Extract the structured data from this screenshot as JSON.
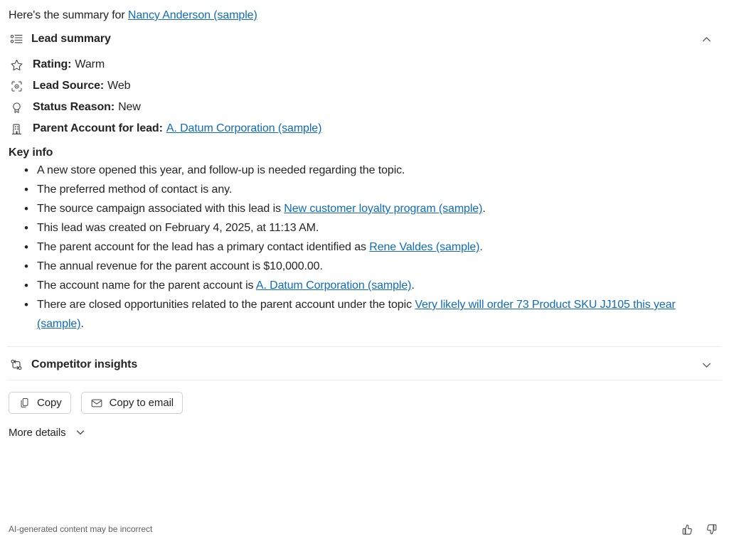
{
  "intro": {
    "prefix": "Here's the summary for ",
    "subject_link": "Nancy Anderson (sample)"
  },
  "lead_summary": {
    "icon": "bulleted-list-icon",
    "title": "Lead summary",
    "expanded": true,
    "chevron_icon": "chevron-up-icon",
    "fields": [
      {
        "icon": "star-icon",
        "label": "Rating:",
        "value": "Warm",
        "is_link": false
      },
      {
        "icon": "target-scan-icon",
        "label": "Lead Source:",
        "value": "Web",
        "is_link": false
      },
      {
        "icon": "ribbon-award-icon",
        "label": "Status Reason:",
        "value": "New",
        "is_link": false
      },
      {
        "icon": "building-icon",
        "label": "Parent Account for lead:",
        "value": "A. Datum Corporation (sample)",
        "is_link": true
      }
    ],
    "key_info_title": "Key info",
    "key_info": [
      {
        "parts": [
          {
            "t": "A new store opened this year, and follow-up is needed regarding the topic.",
            "link": false
          }
        ]
      },
      {
        "parts": [
          {
            "t": "The preferred method of contact is any.",
            "link": false
          }
        ]
      },
      {
        "parts": [
          {
            "t": "The source campaign associated with this lead is ",
            "link": false
          },
          {
            "t": "New customer loyalty program (sample)",
            "link": true
          },
          {
            "t": ".",
            "link": false
          }
        ]
      },
      {
        "parts": [
          {
            "t": "This lead was created on February 4, 2025, at 11:13 AM.",
            "link": false
          }
        ]
      },
      {
        "parts": [
          {
            "t": "The parent account for the lead has a primary contact identified as ",
            "link": false
          },
          {
            "t": "Rene Valdes (sample)",
            "link": true
          },
          {
            "t": ".",
            "link": false
          }
        ]
      },
      {
        "parts": [
          {
            "t": "The annual revenue for the parent account is $10,000.00.",
            "link": false
          }
        ]
      },
      {
        "parts": [
          {
            "t": "The account name for the parent account is ",
            "link": false
          },
          {
            "t": "A. Datum Corporation (sample)",
            "link": true
          },
          {
            "t": ".",
            "link": false
          }
        ]
      },
      {
        "parts": [
          {
            "t": "There are closed opportunities related to the parent account under the topic ",
            "link": false
          },
          {
            "t": "Very likely will order 73 Product SKU JJ105 this year (sample)",
            "link": true
          },
          {
            "t": ".",
            "link": false
          }
        ]
      }
    ]
  },
  "competitor_insights": {
    "icon": "branch-compare-icon",
    "title": "Competitor insights",
    "expanded": false,
    "chevron_icon": "chevron-down-icon"
  },
  "actions": {
    "copy": {
      "label": "Copy",
      "icon": "copy-icon"
    },
    "copy_to_email": {
      "label": "Copy to email",
      "icon": "mail-icon"
    }
  },
  "more_details": {
    "label": "More details",
    "chevron_icon": "chevron-down-icon"
  },
  "footer": {
    "disclaimer": "AI-generated content may be incorrect",
    "like_icon": "thumbs-up-icon",
    "dislike_icon": "thumbs-down-icon"
  },
  "colors": {
    "link": "#0f6cbd",
    "text": "#242424",
    "muted": "#616161",
    "divider": "#ebebeb",
    "button_border": "#d1d1d1"
  }
}
